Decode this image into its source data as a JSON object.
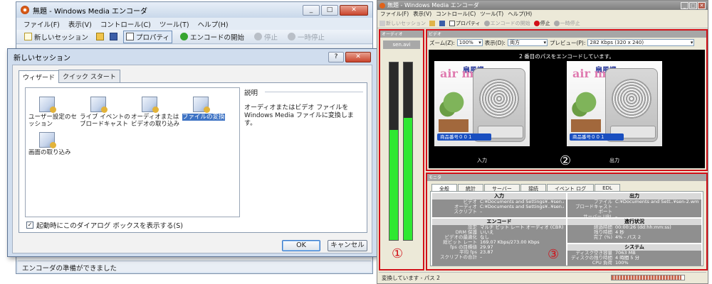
{
  "left_window": {
    "title": "無題 - Windows Media エンコーダ",
    "controls": [
      "_",
      "□",
      "✕"
    ],
    "menu": [
      "ファイル(F)",
      "表示(V)",
      "コントロール(C)",
      "ツール(T)",
      "ヘルプ(H)"
    ],
    "toolbar": {
      "new_session": "新しいセッション",
      "properties": "プロパティ",
      "start_encode": "エンコードの開始",
      "stop": "停止",
      "pause": "一時停止"
    },
    "status": "エンコーダの準備ができました"
  },
  "dialog": {
    "title": "新しいセッション",
    "help_btn": "?",
    "close_btn": "✕",
    "tabs": [
      "ウィザード",
      "クイック スタート"
    ],
    "items": [
      "ユーザー設定のセッション",
      "ライブ イベントのブロードキャスト",
      "オーディオまたはビデオの取り込み",
      "ファイルの変換",
      "画面の取り込み"
    ],
    "desc_title": "説明",
    "desc_text": "オーディオまたはビデオ ファイルを Windows Media ファイルに変換します。",
    "checkbox_label": "起動時にこのダイアログ ボックスを表示する(S)",
    "checkbox_checked": true,
    "ok": "OK",
    "cancel": "キャンセル"
  },
  "right_window": {
    "title": "無題 - Windows Media エンコーダ",
    "menu": [
      "ファイル(F)",
      "表示(V)",
      "コントロール(C)",
      "ツール(T)",
      "ヘルプ(H)"
    ],
    "toolbar": {
      "new_session": "新しいセッション",
      "properties": "プロパティ",
      "start_encode": "エンコードの開始",
      "stop": "停止",
      "pause": "一時停止"
    },
    "audio_panel": {
      "header": "オーディオ",
      "file": "sen.avi",
      "meter_levels": [
        0.62,
        0.69
      ],
      "marker": "①"
    },
    "video_panel": {
      "header": "ビデオ",
      "zoom_label": "ズーム(Z):",
      "zoom_value": "100%",
      "view_label": "表示(D):",
      "view_value": "両方",
      "preview_label": "プレビュー(P):",
      "preview_value": "282 Kbps (320 x 240)",
      "message": "2 番目のパスをエンコードしています。",
      "brand": "air mate",
      "brand_top": "扇風機",
      "product_tag": "商品番号００１",
      "input_label": "入力",
      "output_label": "出力",
      "marker": "②"
    },
    "stats_panel": {
      "header": "モニタ",
      "tabs": [
        "全般",
        "統計",
        "サーバー",
        "接続",
        "イベント ログ",
        "EDL"
      ],
      "input": {
        "heading": "入力",
        "rows": [
          [
            "ビデオ",
            "C:¥Documents and Settings¥..¥sen.avi"
          ],
          [
            "オーディオ",
            "C:¥Documents and Settings¥..¥sen.avi"
          ],
          [
            "スクリプト",
            "–"
          ]
        ]
      },
      "output": {
        "heading": "出力",
        "rows": [
          [
            "ファイル",
            "C:¥Documents and Sett..¥sen-2.wmv"
          ],
          [
            "ブロードキャスト ポート",
            "–"
          ],
          [
            "サーバー URL",
            "–"
          ]
        ]
      },
      "encode": {
        "heading": "エンコード",
        "rows": [
          [
            "設定",
            "マルチ ビット レート オーディオ (CBR) / マ"
          ],
          [
            "DRM 保護",
            "いいえ"
          ],
          [
            "ビデオの最適化",
            "なし"
          ],
          [
            "総ビット レート",
            "169.07 Kbps/273.00 Kbps"
          ],
          [
            "fps の目標値",
            "29.97"
          ],
          [
            "平均 fps",
            "23.87"
          ],
          [
            "スクリプトの合計",
            "–"
          ]
        ]
      },
      "progress": {
        "heading": "進行状況",
        "rows": [
          [
            "経過時間",
            "00:00:26 (dd:hh:mm:ss)"
          ],
          [
            "残り時間",
            "4 秒"
          ],
          [
            "完了 (%)",
            "4% - パス 2"
          ]
        ]
      },
      "system": {
        "heading": "システム",
        "rows": [
          [
            "ディスク空き容量",
            "7063 MB"
          ],
          [
            "ディスクの残り時間",
            "4 時間 5 分"
          ],
          [
            "CPU 負荷",
            "100%"
          ]
        ]
      },
      "marker": "③"
    },
    "status": "変換しています - パス 2",
    "progress_fraction": 0.96
  }
}
